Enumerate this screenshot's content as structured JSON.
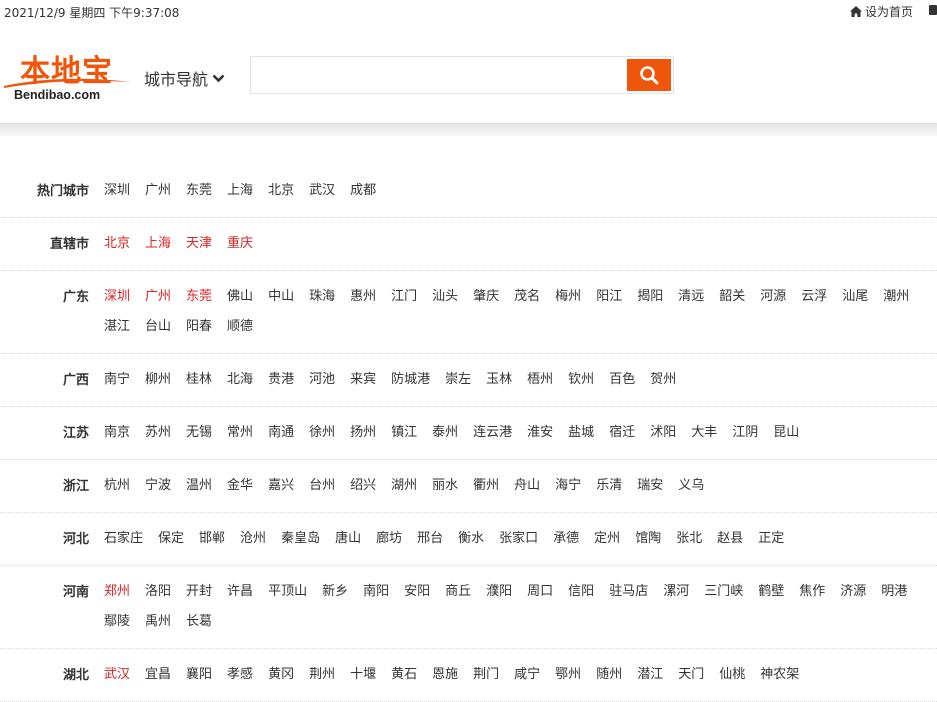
{
  "topbar": {
    "datetime": "2021/12/9 星期四 下午9:37:08",
    "set_home": "设为首页"
  },
  "header": {
    "logo_cn": "本地宝",
    "logo_en": "Bendibao.com",
    "city_nav": "城市导航",
    "search_value": "",
    "search_icon": "search-icon"
  },
  "colors": {
    "brand_orange": "#f0560b",
    "highlight_red": "#dd2222"
  },
  "regions": [
    {
      "label": "热门城市",
      "cities": [
        {
          "name": "深圳"
        },
        {
          "name": "广州"
        },
        {
          "name": "东莞"
        },
        {
          "name": "上海"
        },
        {
          "name": "北京"
        },
        {
          "name": "武汉"
        },
        {
          "name": "成都"
        }
      ]
    },
    {
      "label": "直辖市",
      "cities": [
        {
          "name": "北京",
          "hl": true
        },
        {
          "name": "上海",
          "hl": true
        },
        {
          "name": "天津",
          "hl": true
        },
        {
          "name": "重庆",
          "hl": true
        }
      ]
    },
    {
      "label": "广东",
      "cities": [
        {
          "name": "深圳",
          "hl": true
        },
        {
          "name": "广州",
          "hl": true
        },
        {
          "name": "东莞",
          "hl": true
        },
        {
          "name": "佛山"
        },
        {
          "name": "中山"
        },
        {
          "name": "珠海"
        },
        {
          "name": "惠州"
        },
        {
          "name": "江门"
        },
        {
          "name": "汕头"
        },
        {
          "name": "肇庆"
        },
        {
          "name": "茂名"
        },
        {
          "name": "梅州"
        },
        {
          "name": "阳江"
        },
        {
          "name": "揭阳"
        },
        {
          "name": "清远"
        },
        {
          "name": "韶关"
        },
        {
          "name": "河源"
        },
        {
          "name": "云浮"
        },
        {
          "name": "汕尾"
        },
        {
          "name": "潮州"
        },
        {
          "name": "湛江"
        },
        {
          "name": "台山"
        },
        {
          "name": "阳春"
        },
        {
          "name": "顺德"
        }
      ]
    },
    {
      "label": "广西",
      "cities": [
        {
          "name": "南宁"
        },
        {
          "name": "柳州"
        },
        {
          "name": "桂林"
        },
        {
          "name": "北海"
        },
        {
          "name": "贵港"
        },
        {
          "name": "河池"
        },
        {
          "name": "来宾"
        },
        {
          "name": "防城港"
        },
        {
          "name": "崇左"
        },
        {
          "name": "玉林"
        },
        {
          "name": "梧州"
        },
        {
          "name": "钦州"
        },
        {
          "name": "百色"
        },
        {
          "name": "贺州"
        }
      ]
    },
    {
      "label": "江苏",
      "cities": [
        {
          "name": "南京"
        },
        {
          "name": "苏州"
        },
        {
          "name": "无锡"
        },
        {
          "name": "常州"
        },
        {
          "name": "南通"
        },
        {
          "name": "徐州"
        },
        {
          "name": "扬州"
        },
        {
          "name": "镇江"
        },
        {
          "name": "泰州"
        },
        {
          "name": "连云港"
        },
        {
          "name": "淮安"
        },
        {
          "name": "盐城"
        },
        {
          "name": "宿迁"
        },
        {
          "name": "沭阳"
        },
        {
          "name": "大丰"
        },
        {
          "name": "江阴"
        },
        {
          "name": "昆山"
        }
      ]
    },
    {
      "label": "浙江",
      "cities": [
        {
          "name": "杭州"
        },
        {
          "name": "宁波"
        },
        {
          "name": "温州"
        },
        {
          "name": "金华"
        },
        {
          "name": "嘉兴"
        },
        {
          "name": "台州"
        },
        {
          "name": "绍兴"
        },
        {
          "name": "湖州"
        },
        {
          "name": "丽水"
        },
        {
          "name": "衢州"
        },
        {
          "name": "舟山"
        },
        {
          "name": "海宁"
        },
        {
          "name": "乐清"
        },
        {
          "name": "瑞安"
        },
        {
          "name": "义乌"
        }
      ]
    },
    {
      "label": "河北",
      "cities": [
        {
          "name": "石家庄"
        },
        {
          "name": "保定"
        },
        {
          "name": "邯郸"
        },
        {
          "name": "沧州"
        },
        {
          "name": "秦皇岛"
        },
        {
          "name": "唐山"
        },
        {
          "name": "廊坊"
        },
        {
          "name": "邢台"
        },
        {
          "name": "衡水"
        },
        {
          "name": "张家口"
        },
        {
          "name": "承德"
        },
        {
          "name": "定州"
        },
        {
          "name": "馆陶"
        },
        {
          "name": "张北"
        },
        {
          "name": "赵县"
        },
        {
          "name": "正定"
        }
      ]
    },
    {
      "label": "河南",
      "cities": [
        {
          "name": "郑州",
          "hl": true
        },
        {
          "name": "洛阳"
        },
        {
          "name": "开封"
        },
        {
          "name": "许昌"
        },
        {
          "name": "平顶山"
        },
        {
          "name": "新乡"
        },
        {
          "name": "南阳"
        },
        {
          "name": "安阳"
        },
        {
          "name": "商丘"
        },
        {
          "name": "濮阳"
        },
        {
          "name": "周口"
        },
        {
          "name": "信阳"
        },
        {
          "name": "驻马店"
        },
        {
          "name": "漯河"
        },
        {
          "name": "三门峡"
        },
        {
          "name": "鹤壁"
        },
        {
          "name": "焦作"
        },
        {
          "name": "济源"
        },
        {
          "name": "明港"
        },
        {
          "name": "鄢陵"
        },
        {
          "name": "禹州"
        },
        {
          "name": "长葛"
        }
      ]
    },
    {
      "label": "湖北",
      "cities": [
        {
          "name": "武汉",
          "hl": true
        },
        {
          "name": "宜昌"
        },
        {
          "name": "襄阳"
        },
        {
          "name": "孝感"
        },
        {
          "name": "黄冈"
        },
        {
          "name": "荆州"
        },
        {
          "name": "十堰"
        },
        {
          "name": "黄石"
        },
        {
          "name": "恩施"
        },
        {
          "name": "荆门"
        },
        {
          "name": "咸宁"
        },
        {
          "name": "鄂州"
        },
        {
          "name": "随州"
        },
        {
          "name": "潜江"
        },
        {
          "name": "天门"
        },
        {
          "name": "仙桃"
        },
        {
          "name": "神农架"
        }
      ]
    }
  ]
}
